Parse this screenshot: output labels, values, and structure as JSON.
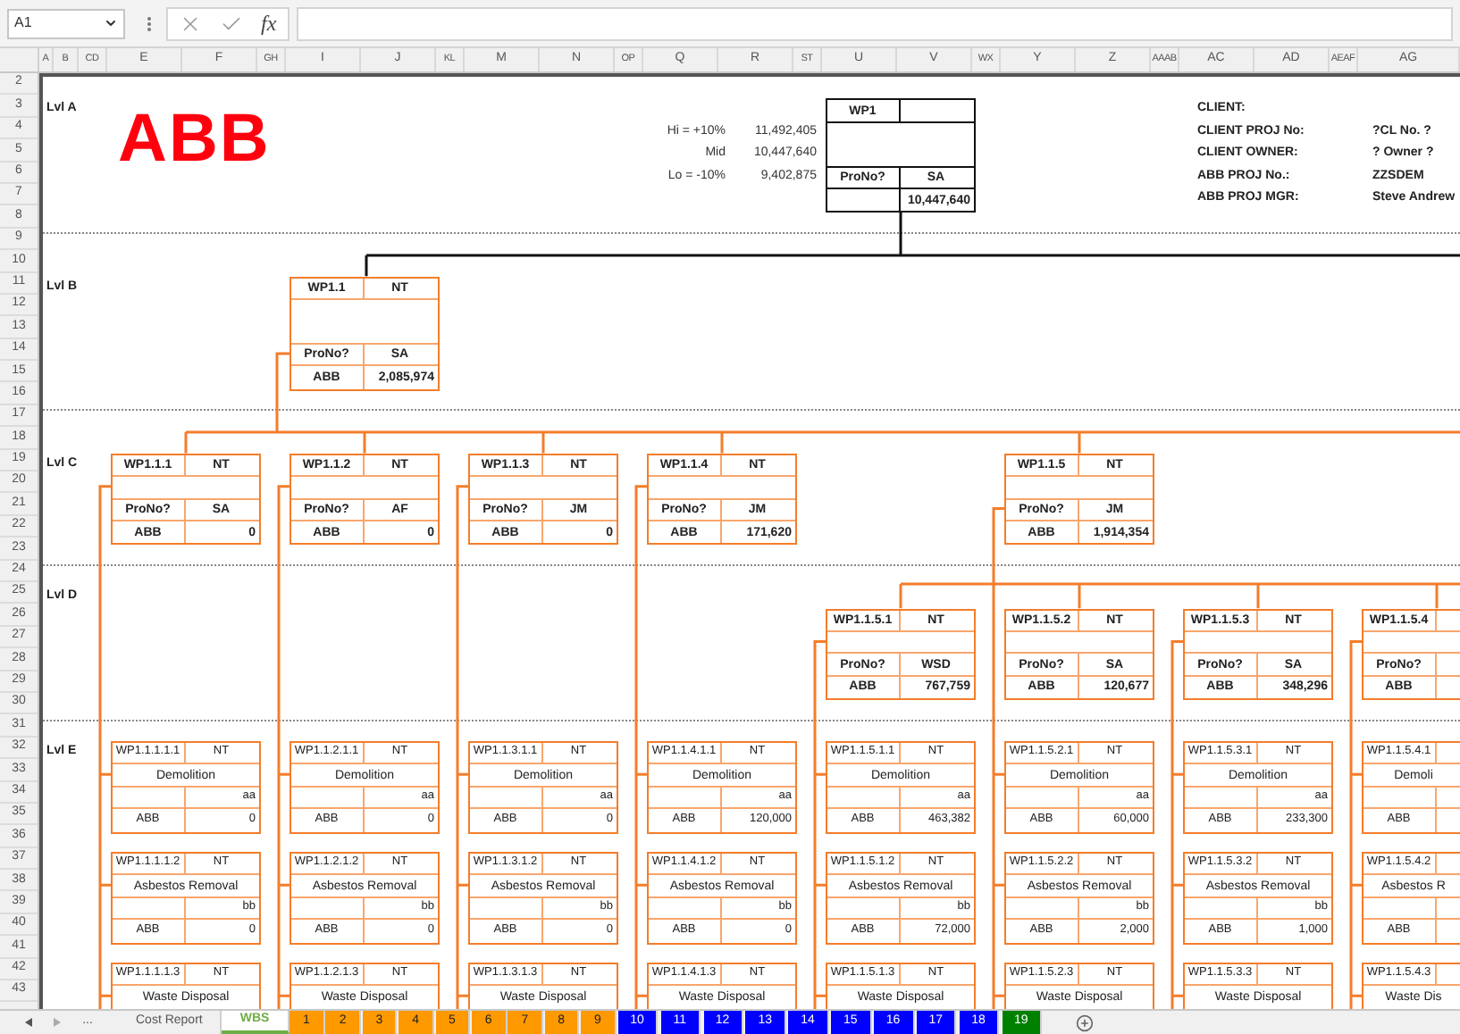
{
  "formula_bar": {
    "name_box": "A1",
    "fx": "fx"
  },
  "columns": [
    "A",
    "B",
    "CD",
    "E",
    "F",
    "GH",
    "I",
    "J",
    "KL",
    "M",
    "N",
    "OP",
    "Q",
    "R",
    "ST",
    "U",
    "V",
    "WX",
    "Y",
    "Z",
    "AAAB",
    "AC",
    "AD",
    "AEAF",
    "AG"
  ],
  "rows": [
    "2",
    "3",
    "4",
    "5",
    "6",
    "7",
    "8",
    "9",
    "10",
    "11",
    "12",
    "13",
    "14",
    "15",
    "16",
    "17",
    "18",
    "19",
    "20",
    "21",
    "22",
    "23",
    "24",
    "25",
    "26",
    "27",
    "28",
    "29",
    "30",
    "31",
    "32",
    "33",
    "34",
    "35",
    "36",
    "37",
    "38",
    "39",
    "40",
    "41",
    "42",
    "43"
  ],
  "levels": [
    {
      "label": "Lvl A"
    },
    {
      "label": "Lvl B"
    },
    {
      "label": "Lvl C"
    },
    {
      "label": "Lvl D"
    },
    {
      "label": "Lvl E"
    }
  ],
  "logo": "ABB",
  "estimate": [
    {
      "label": "Hi = +10%",
      "value": "11,492,405"
    },
    {
      "label": "Mid",
      "value": "10,447,640"
    },
    {
      "label": "Lo = -10%",
      "value": "9,402,875"
    }
  ],
  "project_info": [
    {
      "label": "CLIENT:"
    },
    {
      "label": "CLIENT PROJ No:",
      "value": "?CL No. ?"
    },
    {
      "label": "CLIENT OWNER:",
      "value": "? Owner ?"
    },
    {
      "label": "ABB PROJ No.:",
      "value": "ZZSDEM"
    },
    {
      "label": "ABB PROJ MGR:",
      "value": "Steve Andrew"
    }
  ],
  "root": {
    "id": "WP1",
    "pro_label": "ProNo?",
    "owner": "SA",
    "total": "10,447,640"
  },
  "level_b": [
    {
      "id": "WP1.1",
      "status": "NT",
      "pro_label": "ProNo?",
      "owner": "SA",
      "org": "ABB",
      "total": "2,085,974"
    }
  ],
  "level_c": [
    {
      "id": "WP1.1.1",
      "status": "NT",
      "pro_label": "ProNo?",
      "owner": "SA",
      "org": "ABB",
      "total": "0"
    },
    {
      "id": "WP1.1.2",
      "status": "NT",
      "pro_label": "ProNo?",
      "owner": "AF",
      "org": "ABB",
      "total": "0"
    },
    {
      "id": "WP1.1.3",
      "status": "NT",
      "pro_label": "ProNo?",
      "owner": "JM",
      "org": "ABB",
      "total": "0"
    },
    {
      "id": "WP1.1.4",
      "status": "NT",
      "pro_label": "ProNo?",
      "owner": "JM",
      "org": "ABB",
      "total": "171,620"
    },
    {
      "id": "WP1.1.5",
      "status": "NT",
      "pro_label": "ProNo?",
      "owner": "JM",
      "org": "ABB",
      "total": "1,914,354"
    }
  ],
  "level_d": [
    {
      "id": "WP1.1.5.1",
      "status": "NT",
      "pro_label": "ProNo?",
      "owner": "WSD",
      "org": "ABB",
      "total": "767,759"
    },
    {
      "id": "WP1.1.5.2",
      "status": "NT",
      "pro_label": "ProNo?",
      "owner": "SA",
      "org": "ABB",
      "total": "120,677"
    },
    {
      "id": "WP1.1.5.3",
      "status": "NT",
      "pro_label": "ProNo?",
      "owner": "SA",
      "org": "ABB",
      "total": "348,296"
    },
    {
      "id": "WP1.1.5.4",
      "pro_label": "ProNo?",
      "org": "ABB"
    }
  ],
  "level_e": [
    {
      "tasks": [
        {
          "id": "WP1.1.1.1.1",
          "status": "NT",
          "desc": "Demolition",
          "code": "aa",
          "org": "ABB",
          "total": "0"
        },
        {
          "id": "WP1.1.1.1.2",
          "status": "NT",
          "desc": "Asbestos Removal",
          "code": "bb",
          "org": "ABB",
          "total": "0"
        },
        {
          "id": "WP1.1.1.1.3",
          "status": "NT",
          "desc": "Waste Disposal"
        }
      ]
    },
    {
      "tasks": [
        {
          "id": "WP1.1.2.1.1",
          "status": "NT",
          "desc": "Demolition",
          "code": "aa",
          "org": "ABB",
          "total": "0"
        },
        {
          "id": "WP1.1.2.1.2",
          "status": "NT",
          "desc": "Asbestos Removal",
          "code": "bb",
          "org": "ABB",
          "total": "0"
        },
        {
          "id": "WP1.1.2.1.3",
          "status": "NT",
          "desc": "Waste Disposal"
        }
      ]
    },
    {
      "tasks": [
        {
          "id": "WP1.1.3.1.1",
          "status": "NT",
          "desc": "Demolition",
          "code": "aa",
          "org": "ABB",
          "total": "0"
        },
        {
          "id": "WP1.1.3.1.2",
          "status": "NT",
          "desc": "Asbestos Removal",
          "code": "bb",
          "org": "ABB",
          "total": "0"
        },
        {
          "id": "WP1.1.3.1.3",
          "status": "NT",
          "desc": "Waste Disposal"
        }
      ]
    },
    {
      "tasks": [
        {
          "id": "WP1.1.4.1.1",
          "status": "NT",
          "desc": "Demolition",
          "code": "aa",
          "org": "ABB",
          "total": "120,000"
        },
        {
          "id": "WP1.1.4.1.2",
          "status": "NT",
          "desc": "Asbestos Removal",
          "code": "bb",
          "org": "ABB",
          "total": "0"
        },
        {
          "id": "WP1.1.4.1.3",
          "status": "NT",
          "desc": "Waste Disposal"
        }
      ]
    },
    {
      "tasks": [
        {
          "id": "WP1.1.5.1.1",
          "status": "NT",
          "desc": "Demolition",
          "code": "aa",
          "org": "ABB",
          "total": "463,382"
        },
        {
          "id": "WP1.1.5.1.2",
          "status": "NT",
          "desc": "Asbestos Removal",
          "code": "bb",
          "org": "ABB",
          "total": "72,000"
        },
        {
          "id": "WP1.1.5.1.3",
          "status": "NT",
          "desc": "Waste Disposal"
        }
      ]
    },
    {
      "tasks": [
        {
          "id": "WP1.1.5.2.1",
          "status": "NT",
          "desc": "Demolition",
          "code": "aa",
          "org": "ABB",
          "total": "60,000"
        },
        {
          "id": "WP1.1.5.2.2",
          "status": "NT",
          "desc": "Asbestos Removal",
          "code": "bb",
          "org": "ABB",
          "total": "2,000"
        },
        {
          "id": "WP1.1.5.2.3",
          "status": "NT",
          "desc": "Waste Disposal"
        }
      ]
    },
    {
      "tasks": [
        {
          "id": "WP1.1.5.3.1",
          "status": "NT",
          "desc": "Demolition",
          "code": "aa",
          "org": "ABB",
          "total": "233,300"
        },
        {
          "id": "WP1.1.5.3.2",
          "status": "NT",
          "desc": "Asbestos Removal",
          "code": "bb",
          "org": "ABB",
          "total": "1,000"
        },
        {
          "id": "WP1.1.5.3.3",
          "status": "NT",
          "desc": "Waste Disposal"
        }
      ]
    },
    {
      "tasks": [
        {
          "id": "WP1.1.5.4.1",
          "desc": "Demoli",
          "org": "ABB"
        },
        {
          "id": "WP1.1.5.4.2",
          "desc": "Asbestos R",
          "org": "ABB"
        },
        {
          "id": "WP1.1.5.4.3",
          "desc": "Waste Dis"
        }
      ]
    }
  ],
  "tab_nav_more": "...",
  "sheet_tabs": [
    {
      "label": "Cost Report",
      "selected": false
    },
    {
      "label": "WBS",
      "selected": true,
      "color": "#70ad47"
    },
    {
      "label": "1",
      "selected": false,
      "color": "#ff9900"
    },
    {
      "label": "2",
      "selected": false,
      "color": "#ff9900"
    },
    {
      "label": "3",
      "selected": false,
      "color": "#ff9900"
    },
    {
      "label": "4",
      "selected": false,
      "color": "#ff9900"
    },
    {
      "label": "5",
      "selected": false,
      "color": "#ff9900"
    },
    {
      "label": "6",
      "selected": false,
      "color": "#ff9900"
    },
    {
      "label": "7",
      "selected": false,
      "color": "#ff9900"
    },
    {
      "label": "8",
      "selected": false,
      "color": "#ff9900"
    },
    {
      "label": "9",
      "selected": false,
      "color": "#ff9900"
    },
    {
      "label": "10",
      "selected": false,
      "color": "#0000ff"
    },
    {
      "label": "11",
      "selected": false,
      "color": "#0000ff"
    },
    {
      "label": "12",
      "selected": false,
      "color": "#0000ff"
    },
    {
      "label": "13",
      "selected": false,
      "color": "#0000ff"
    },
    {
      "label": "14",
      "selected": false,
      "color": "#0000ff"
    },
    {
      "label": "15",
      "selected": false,
      "color": "#0000ff"
    },
    {
      "label": "16",
      "selected": false,
      "color": "#0000ff"
    },
    {
      "label": "17",
      "selected": false,
      "color": "#0000ff"
    },
    {
      "label": "18",
      "selected": false,
      "color": "#0000ff"
    },
    {
      "label": "19",
      "selected": false,
      "color": "#008000"
    }
  ]
}
